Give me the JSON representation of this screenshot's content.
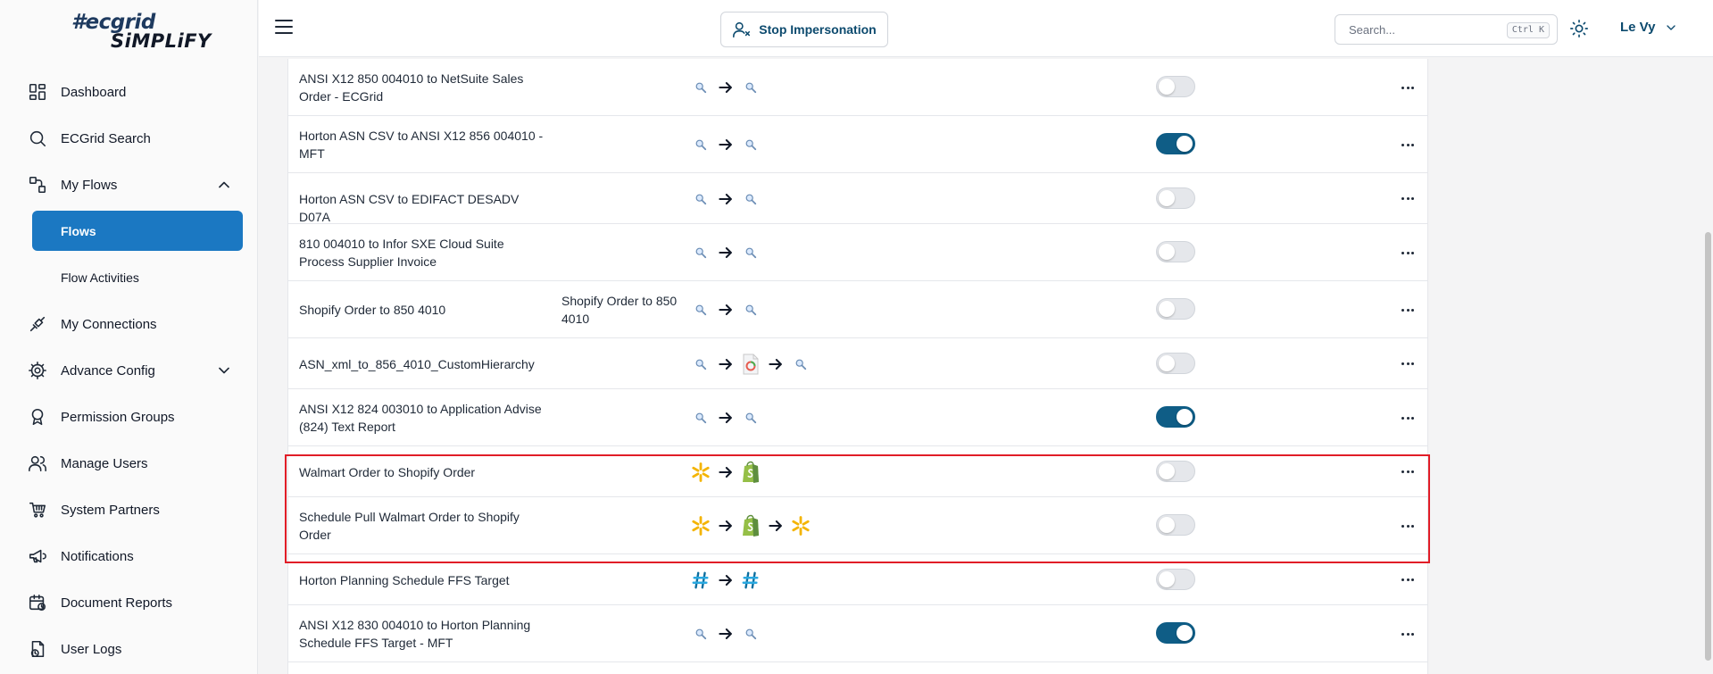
{
  "brand": {
    "line1": "#ecgrid",
    "line2": "SiMPLiFY"
  },
  "header": {
    "stop_label": "Stop Impersonation",
    "search_placeholder": "Search...",
    "search_kbd": "Ctrl K",
    "user_name": "Le Vy"
  },
  "sidebar": {
    "items": [
      {
        "label": "Dashboard",
        "icon": "dashboard-icon"
      },
      {
        "label": "ECGrid Search",
        "icon": "search-icon"
      },
      {
        "label": "My Flows",
        "icon": "flows-icon"
      },
      {
        "label": "Flows"
      },
      {
        "label": "Flow Activities"
      },
      {
        "label": "My Connections",
        "icon": "plug-icon"
      },
      {
        "label": "Advance Config",
        "icon": "gear-icon"
      },
      {
        "label": "Permission Groups",
        "icon": "badge-icon"
      },
      {
        "label": "Manage Users",
        "icon": "users-icon"
      },
      {
        "label": "System Partners",
        "icon": "cart-icon"
      },
      {
        "label": "Notifications",
        "icon": "megaphone-icon"
      },
      {
        "label": "Document Reports",
        "icon": "calendar-icon"
      },
      {
        "label": "User Logs",
        "icon": "logs-icon"
      }
    ]
  },
  "flows": [
    {
      "name": "ANSI X12 850 004010 to NetSuite Sales Order - ECGrid",
      "desc": "",
      "steps": [
        "generic",
        "generic"
      ],
      "enabled": false
    },
    {
      "name": "Horton ASN CSV to ANSI X12 856 004010 - MFT",
      "desc": "",
      "steps": [
        "generic",
        "generic"
      ],
      "enabled": true
    },
    {
      "name": "Horton ASN CSV to EDIFACT DESADV D07A",
      "desc": "",
      "steps": [
        "generic",
        "generic"
      ],
      "enabled": false
    },
    {
      "name": "810 004010 to Infor SXE Cloud Suite Process Supplier Invoice",
      "desc": "",
      "steps": [
        "generic",
        "generic"
      ],
      "enabled": false
    },
    {
      "name": "Shopify Order to 850 4010",
      "desc": "Shopify Order to 850 4010",
      "steps": [
        "generic",
        "generic"
      ],
      "enabled": false
    },
    {
      "name": "ASN_xml_to_856_4010_CustomHierarchy",
      "desc": "",
      "steps": [
        "generic",
        "document",
        "generic"
      ],
      "enabled": false
    },
    {
      "name": "ANSI X12 824 003010 to Application Advise (824) Text Report",
      "desc": "",
      "steps": [
        "generic",
        "generic"
      ],
      "enabled": true
    },
    {
      "name": "Walmart Order to Shopify Order",
      "desc": "",
      "steps": [
        "walmart",
        "shopify"
      ],
      "enabled": false
    },
    {
      "name": "Schedule Pull Walmart Order to Shopify Order",
      "desc": "",
      "steps": [
        "walmart",
        "shopify",
        "walmart"
      ],
      "enabled": false
    },
    {
      "name": "Horton Planning Schedule FFS Target",
      "desc": "",
      "steps": [
        "hash",
        "hash"
      ],
      "enabled": false
    },
    {
      "name": "ANSI X12 830 004010 to Horton Planning Schedule FFS Target - MFT",
      "desc": "",
      "steps": [
        "generic",
        "generic"
      ],
      "enabled": true
    }
  ]
}
